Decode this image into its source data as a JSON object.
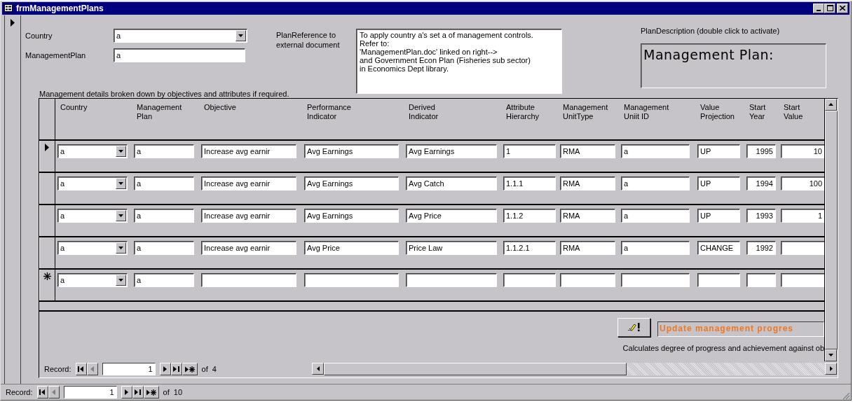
{
  "window": {
    "title": "frmManagementPlans"
  },
  "form": {
    "current_record": true,
    "fields": [
      {
        "label": "Country",
        "value": "a",
        "kind": "combo"
      },
      {
        "label": "ManagementPlan",
        "value": "a",
        "kind": "text"
      }
    ],
    "plan_reference": {
      "label": [
        "PlanReference to",
        "external document"
      ],
      "lines": [
        "To apply country a's set a of management controls.",
        "Refer to:",
        "'ManagementPlan.doc' linked on right-->",
        "and Government Econ Plan (Fisheries sub sector)",
        "in Economics Dept library."
      ]
    },
    "plan_description": {
      "label": "PlanDescription (double click to activate)",
      "heading": "Management Plan:"
    },
    "details_caption": "Management details broken down by objectives and attributes if required."
  },
  "subform": {
    "columns": [
      {
        "label": [
          "Country"
        ],
        "kind": "combo"
      },
      {
        "label": [
          "Management",
          "Plan"
        ],
        "kind": "text"
      },
      {
        "label": [
          "Objective"
        ],
        "kind": "text"
      },
      {
        "label": [
          "Performance",
          "Indicator"
        ],
        "kind": "text"
      },
      {
        "label": [
          "Derived",
          "Indicator"
        ],
        "kind": "text"
      },
      {
        "label": [
          "Attribute",
          "Hierarchy"
        ],
        "kind": "text"
      },
      {
        "label": [
          "Management",
          "UnitType"
        ],
        "kind": "text"
      },
      {
        "label": [
          "Management",
          "Uniit ID"
        ],
        "kind": "text"
      },
      {
        "label": [
          "Value",
          "Projection"
        ],
        "kind": "text"
      },
      {
        "label": [
          "Start",
          "Year"
        ],
        "kind": "number"
      },
      {
        "label": [
          "Start",
          "Value"
        ],
        "kind": "number"
      }
    ],
    "rows": [
      {
        "kind": "current",
        "cells": [
          "a",
          "a",
          "Increase avg earnir",
          "Avg Earnings",
          "Avg Earnings",
          "1",
          "RMA",
          "a",
          "UP",
          "1995",
          "10"
        ]
      },
      {
        "kind": "record",
        "cells": [
          "a",
          "a",
          "Increase avg earnir",
          "Avg Earnings",
          "Avg Catch",
          "1.1.1",
          "RMA",
          "a",
          "UP",
          "1994",
          "100"
        ]
      },
      {
        "kind": "record",
        "cells": [
          "a",
          "a",
          "Increase avg earnir",
          "Avg Earnings",
          "Avg Price",
          "1.1.2",
          "RMA",
          "a",
          "UP",
          "1993",
          "1"
        ]
      },
      {
        "kind": "record",
        "cells": [
          "a",
          "a",
          "Increase avg earnir",
          "Avg Price",
          "Price Law",
          "1.1.2.1",
          "RMA",
          "a",
          "CHANGE",
          "1992",
          null
        ]
      },
      {
        "kind": "new",
        "cells": [
          "a",
          "a",
          null,
          null,
          null,
          null,
          null,
          null,
          null,
          null,
          null
        ]
      }
    ],
    "update_button": {
      "label": "Update management progres"
    },
    "update_note": "Calculates degree of progress and achievement against ob",
    "record_nav": {
      "label": "Record:",
      "current": "1",
      "total": "of 4",
      "buttons": [
        {
          "kind": "first",
          "disabled": false
        },
        {
          "kind": "prev",
          "disabled": true
        },
        {
          "kind": "next",
          "disabled": false
        },
        {
          "kind": "last",
          "disabled": false
        },
        {
          "kind": "new",
          "disabled": false
        }
      ]
    }
  },
  "record_nav": {
    "label": "Record:",
    "current": "1",
    "total": "of 10",
    "buttons": [
      {
        "kind": "first",
        "disabled": false
      },
      {
        "kind": "prev",
        "disabled": true
      },
      {
        "kind": "next",
        "disabled": false
      },
      {
        "kind": "last",
        "disabled": false
      },
      {
        "kind": "new",
        "disabled": false
      }
    ]
  }
}
